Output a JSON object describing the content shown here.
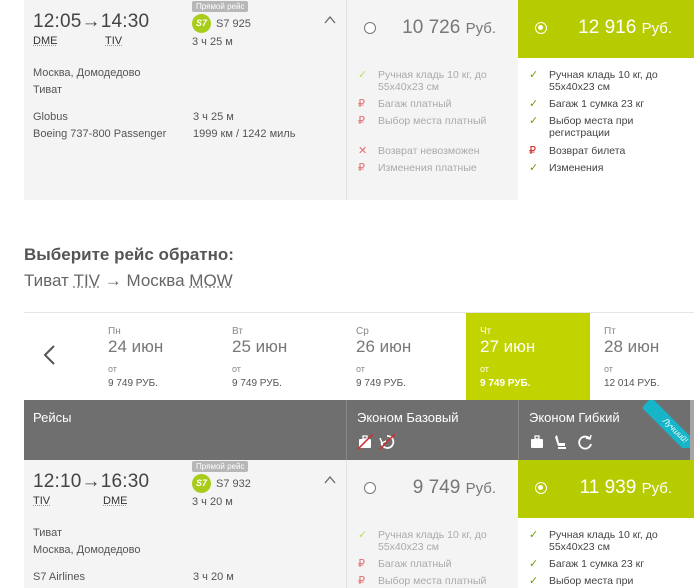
{
  "outbound": {
    "dep_time": "12:05",
    "arr_time": "14:30",
    "dep_code": "DME",
    "arr_code": "TIV",
    "badge": "Прямой рейс",
    "airline_logo": "S7",
    "flight_number": "S7 925",
    "duration": "3 ч 25 м",
    "dep_airport": "Москва, Домодедово",
    "arr_airport": "Тиват",
    "carrier": "Globus",
    "aircraft": "Boeing 737-800 Passenger",
    "duration2": "3 ч 25 м",
    "distance": "1999 км / 1242 миль",
    "fare_basic": {
      "price": "10 726",
      "currency": "Руб.",
      "features": [
        {
          "icon": "check-icon",
          "text": "Ручная кладь 10 кг, до 55х40х23 см"
        },
        {
          "icon": "ruble-icon",
          "text": "Багаж платный"
        },
        {
          "icon": "ruble-icon",
          "text": "Выбор места платный"
        },
        {
          "icon": "cross-icon",
          "text": "Возврат невозможен"
        },
        {
          "icon": "ruble-icon",
          "text": "Изменения платные"
        }
      ]
    },
    "fare_flex": {
      "price": "12 916",
      "currency": "Руб.",
      "features": [
        {
          "icon": "check-icon",
          "text": "Ручная кладь 10 кг, до 55х40х23 см"
        },
        {
          "icon": "check-icon",
          "text": "Багаж 1 сумка 23 кг"
        },
        {
          "icon": "check-icon",
          "text": "Выбор места при регистрации"
        },
        {
          "icon": "ruble-icon",
          "text": "Возврат билета"
        },
        {
          "icon": "check-icon",
          "text": "Изменения"
        }
      ]
    }
  },
  "return_section": {
    "title": "Выберите рейс обратно:",
    "from_city": "Тиват",
    "from_code": "TIV",
    "arrow": "→",
    "to_city": "Москва",
    "to_code": "MOW"
  },
  "dates": [
    {
      "dow": "Пн",
      "day": "24 июн",
      "from": "от",
      "price": "9 749 РУБ.",
      "active": false
    },
    {
      "dow": "Вт",
      "day": "25 июн",
      "from": "от",
      "price": "9 749 РУБ.",
      "active": false
    },
    {
      "dow": "Ср",
      "day": "26 июн",
      "from": "от",
      "price": "9 749 РУБ.",
      "active": false
    },
    {
      "dow": "Чт",
      "day": "27 июн",
      "from": "от",
      "price": "9 749 РУБ.",
      "active": true
    },
    {
      "dow": "Пт",
      "day": "28 июн",
      "from": "от",
      "price": "12 014 РУБ.",
      "active": false
    }
  ],
  "table_header": {
    "flights": "Рейсы",
    "eco_basic": "Эконом Базовый",
    "eco_flex": "Эконом Гибкий",
    "best_badge": "Лучший!"
  },
  "inbound": {
    "dep_time": "12:10",
    "arr_time": "16:30",
    "dep_code": "TIV",
    "arr_code": "DME",
    "badge": "Прямой рейс",
    "airline_logo": "S7",
    "flight_number": "S7 932",
    "duration": "3 ч 20 м",
    "dep_airport": "Тиват",
    "arr_airport": "Москва, Домодедово",
    "carrier": "S7 Airlines",
    "duration2": "3 ч 20 м",
    "fare_basic": {
      "price": "9 749",
      "currency": "Руб.",
      "features": [
        {
          "icon": "check-icon",
          "text": "Ручная кладь 10 кг, до 55х40х23 см"
        },
        {
          "icon": "ruble-icon",
          "text": "Багаж платный"
        },
        {
          "icon": "ruble-icon",
          "text": "Выбор места платный"
        }
      ]
    },
    "fare_flex": {
      "price": "11 939",
      "currency": "Руб.",
      "features": [
        {
          "icon": "check-icon",
          "text": "Ручная кладь 10 кг, до 55х40х23 см"
        },
        {
          "icon": "check-icon",
          "text": "Багаж 1 сумка 23 кг"
        },
        {
          "icon": "check-icon",
          "text": "Выбор места при"
        }
      ]
    }
  },
  "colors": {
    "accent": "#b6cc00",
    "header_bg": "#6f6f6f",
    "ribbon": "#16b5c7"
  }
}
